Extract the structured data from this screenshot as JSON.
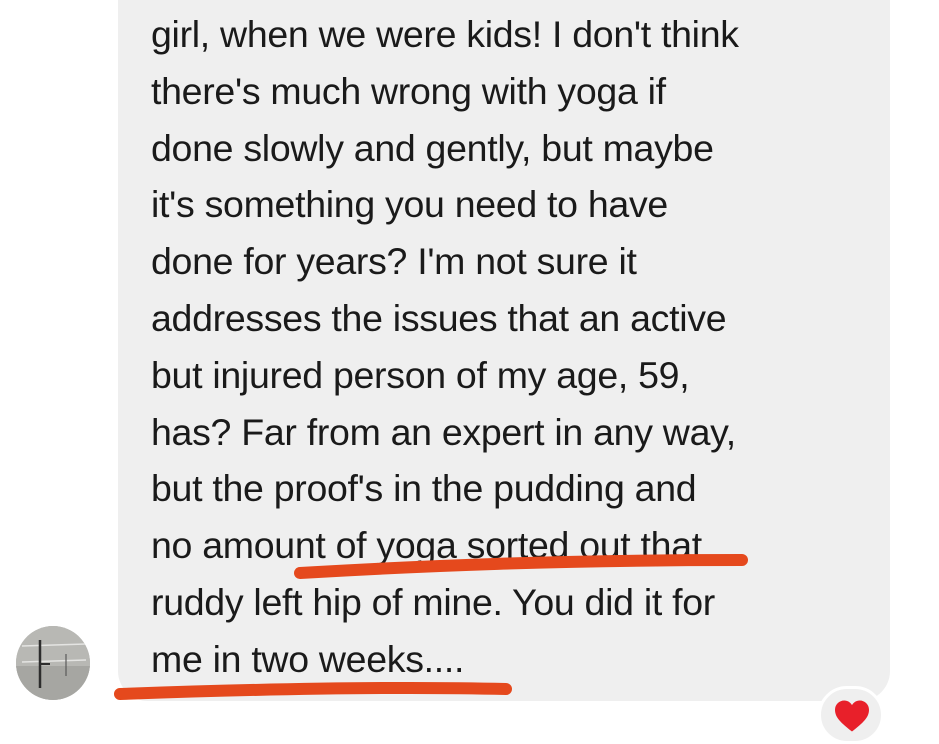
{
  "message": {
    "lines": [
      "girl, when we were kids! I don't think",
      "there's much wrong with yoga if",
      "done slowly and gently, but maybe",
      "it's something you need to have",
      "done for years? I'm not sure it",
      "addresses the issues that an active",
      "but injured person of my age, 59,",
      "has? Far from an expert in any way,",
      "but the proof's in the pudding and",
      "no amount of yoga sorted out that",
      "ruddy left hip of mine. You did it for",
      "me in two weeks...."
    ]
  },
  "sender": {
    "avatar_icon": "profile-photo"
  },
  "reaction": {
    "icon": "heart-icon",
    "color": "#e8202a"
  },
  "annotation": {
    "color": "#e5491d"
  }
}
